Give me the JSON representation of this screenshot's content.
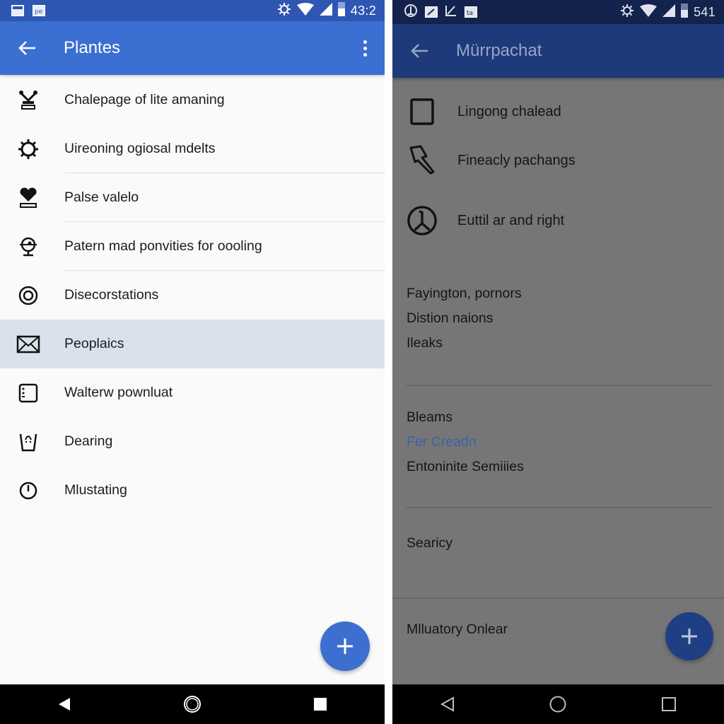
{
  "left_screen": {
    "status_bar": {
      "notification_icons": [
        "image-notification-icon",
        "app-notification-icon"
      ],
      "system_icons": [
        "settings-icon",
        "wifi-icon",
        "signal-icon",
        "battery-icon"
      ],
      "time": "43:2"
    },
    "app_bar": {
      "back_icon": "arrow-left-icon",
      "title": "Plantes",
      "menu_icon": "more-vert-icon"
    },
    "list": [
      {
        "icon": "trophy-icon",
        "label": "Chalepage of lite amaning",
        "selected": false
      },
      {
        "icon": "gear-icon",
        "label": "Uireoning ogiosal mdelts",
        "selected": false
      },
      {
        "icon": "heart-stand-icon",
        "label": "Palse valelo",
        "selected": false
      },
      {
        "icon": "webcam-icon",
        "label": "Patern mad ponvities for oooling",
        "selected": false
      },
      {
        "icon": "target-icon",
        "label": "Disecorstations",
        "selected": false
      },
      {
        "icon": "mail-icon",
        "label": "Peoplaics",
        "selected": true
      },
      {
        "icon": "device-icon",
        "label": "Walterw pownluat",
        "selected": false
      },
      {
        "icon": "basket-icon",
        "label": "Dearing",
        "selected": false
      },
      {
        "icon": "clock-icon",
        "label": "Mlustating",
        "selected": false
      }
    ],
    "fab": {
      "icon": "plus-icon",
      "label": "+"
    },
    "nav_bar": {
      "buttons": [
        "back",
        "home",
        "recents"
      ]
    },
    "colors": {
      "status_bar": "#2f56b3",
      "app_bar": "#3b6fd1",
      "selected_row": "#d9e2ec",
      "fab": "#3c6fd0"
    }
  },
  "right_screen": {
    "status_bar": {
      "notification_icons": [
        "accessibility-icon",
        "image-notification-icon",
        "edit-notification-icon",
        "app-notification-icon"
      ],
      "system_icons": [
        "settings-icon",
        "wifi-icon",
        "signal-icon",
        "battery-icon"
      ],
      "time": "541"
    },
    "app_bar": {
      "back_icon": "arrow-left-icon",
      "title": "Mürrpachat"
    },
    "icon_items": [
      {
        "icon": "square-icon",
        "label": "Lingong chalead"
      },
      {
        "icon": "pen-icon",
        "label": "Fineacly pachangs"
      },
      {
        "icon": "peace-icon",
        "label": "Euttil ar and right"
      }
    ],
    "group1": [
      "Fayington, pornors",
      "Distion naions",
      "Ileaks"
    ],
    "group2": [
      {
        "label": "Bleams",
        "link": false
      },
      {
        "label": "Fer Creadn",
        "link": true
      },
      {
        "label": "Entoninite Semiiies",
        "link": false
      }
    ],
    "group3": [
      "Searicy"
    ],
    "group4": [
      "Mlluatory Onlear"
    ],
    "fab": {
      "icon": "plus-icon",
      "label": "+"
    },
    "nav_bar": {
      "buttons": [
        "back",
        "home",
        "recents"
      ]
    },
    "colors": {
      "scrim_background": "#767676",
      "status_bar": "#14224e",
      "app_bar": "#1f3a7a",
      "link_text": "#3c62a8",
      "fab": "#1f3f85"
    }
  }
}
